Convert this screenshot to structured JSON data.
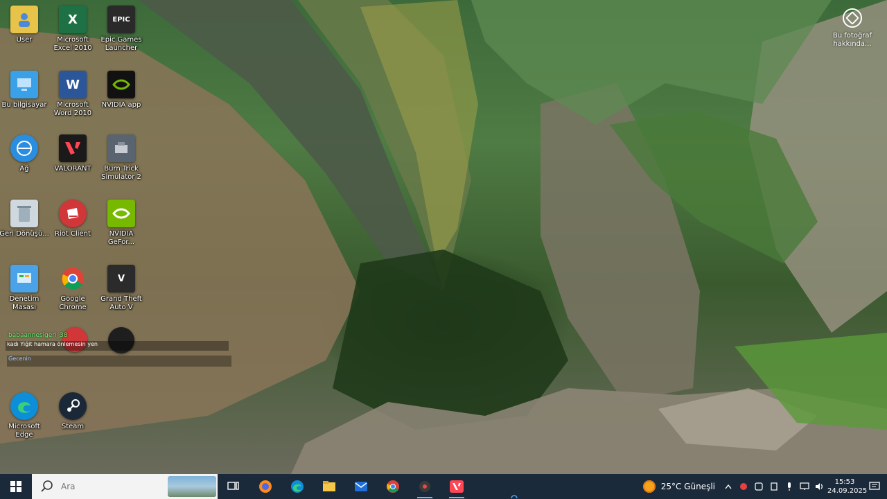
{
  "desktop": {
    "icons": [
      {
        "label": "User"
      },
      {
        "label": "Microsoft Excel 2010"
      },
      {
        "label": "Epic Games Launcher"
      },
      {
        "label": "Bu bilgisayar"
      },
      {
        "label": "Microsoft Word 2010"
      },
      {
        "label": "NVIDIA app"
      },
      {
        "label": "Ağ"
      },
      {
        "label": "VALORANT"
      },
      {
        "label": "Burn Trick Simulator 2"
      },
      {
        "label": "Geri Dönüşü..."
      },
      {
        "label": "Riot Client"
      },
      {
        "label": "NVIDIA GeFor..."
      },
      {
        "label": "Denetim Masası"
      },
      {
        "label": "Google Chrome"
      },
      {
        "label": "Grand Theft Auto V"
      },
      {
        "label": "Microsoft Edge"
      },
      {
        "label": "Steam"
      }
    ],
    "icon_colors": {
      "excel": "#1e7145",
      "word": "#2b579a",
      "epic": "#2a2a2a",
      "nvidia": "#76b900",
      "valorant": "#ff4655",
      "riot": "#d13639",
      "chrome": "#4285f4",
      "edge": "#0c8ed9",
      "steam": "#1b2838"
    },
    "chat_overlay": {
      "user": "babaannesigeri_38",
      "message": "kadı Yiğit hamara önlemesin yen",
      "tag": "Gecenin"
    },
    "photo_info_label": "Bu fotoğraf hakkında..."
  },
  "taskbar": {
    "search_placeholder": "Ara",
    "weather": "25°C Güneşli",
    "time": "15:53",
    "date": "24.09.2025",
    "apps": [
      "task-view",
      "browser",
      "edge",
      "file-explorer",
      "mail",
      "chrome",
      "tool",
      "valorant"
    ]
  }
}
